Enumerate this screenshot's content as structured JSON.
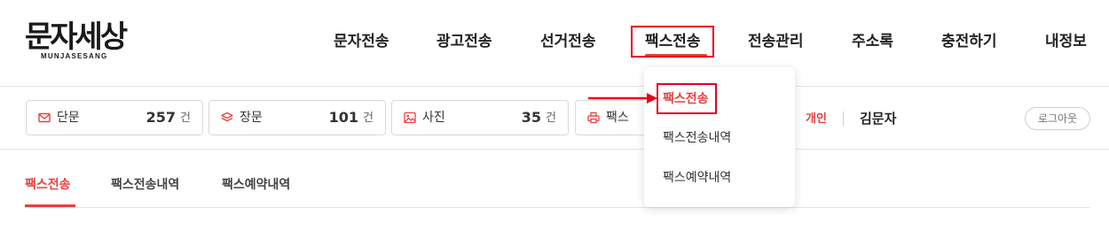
{
  "logo": {
    "main": "문자세상",
    "sub": "MUNJASESANG"
  },
  "nav": [
    {
      "label": "문자전송"
    },
    {
      "label": "광고전송"
    },
    {
      "label": "선거전송"
    },
    {
      "label": "팩스전송"
    },
    {
      "label": "전송관리"
    },
    {
      "label": "주소록"
    },
    {
      "label": "충전하기"
    },
    {
      "label": "내정보"
    }
  ],
  "counts": [
    {
      "label": "단문",
      "value": "257",
      "unit": "건",
      "icon": "mail-icon"
    },
    {
      "label": "장문",
      "value": "101",
      "unit": "건",
      "icon": "layers-icon"
    },
    {
      "label": "사진",
      "value": "35",
      "unit": "건",
      "icon": "image-icon"
    },
    {
      "label": "팩스",
      "icon": "printer-icon"
    }
  ],
  "user": {
    "type": "개인",
    "name": "김문자",
    "logout_label": "로그아웃"
  },
  "subtabs": [
    {
      "label": "팩스전송",
      "active": true
    },
    {
      "label": "팩스전송내역"
    },
    {
      "label": "팩스예약내역"
    }
  ],
  "dropdown": [
    {
      "label": "팩스전송",
      "active": true
    },
    {
      "label": "팩스전송내역"
    },
    {
      "label": "팩스예약내역"
    }
  ],
  "colors": {
    "accent": "#e8403e",
    "annotation": "#e8001b"
  }
}
